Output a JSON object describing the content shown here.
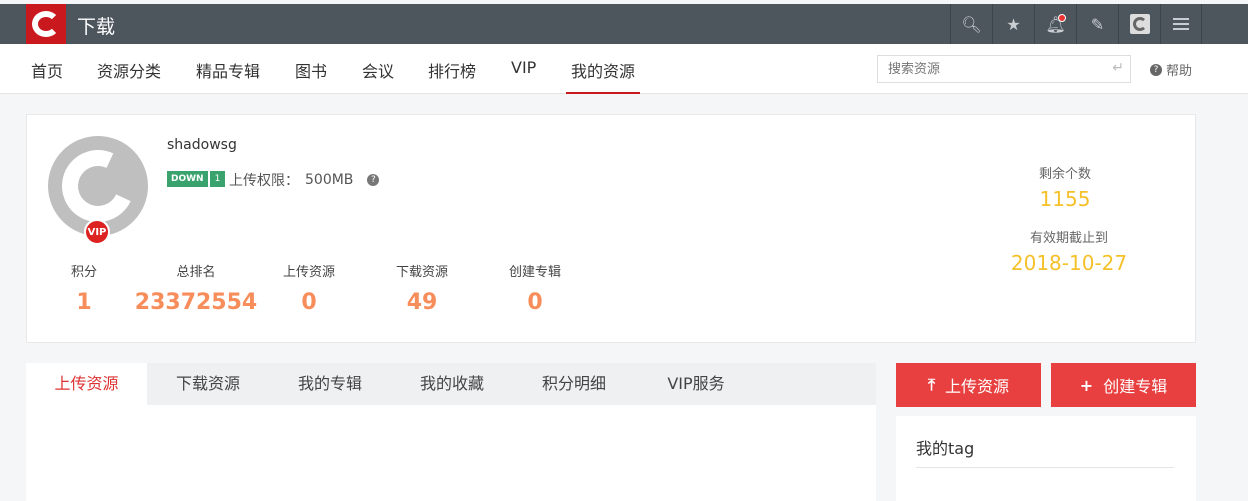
{
  "topbar": {
    "title": "下载"
  },
  "nav": {
    "items": [
      "首页",
      "资源分类",
      "精品专辑",
      "图书",
      "会议",
      "排行榜",
      "VIP",
      "我的资源"
    ],
    "search_placeholder": "搜索资源",
    "help_label": "帮助"
  },
  "profile": {
    "username": "shadowsg",
    "badge_left": "DOWN",
    "badge_right": "1",
    "upload_limit_label": "上传权限：",
    "upload_limit_value": "500MB",
    "vip": "VIP",
    "stats": [
      {
        "label": "积分",
        "value": "1"
      },
      {
        "label": "总排名",
        "value": "23372554"
      },
      {
        "label": "上传资源",
        "value": "0"
      },
      {
        "label": "下载资源",
        "value": "49"
      },
      {
        "label": "创建专辑",
        "value": "0"
      }
    ],
    "remaining_label": "剩余个数",
    "remaining_value": "1155",
    "expire_label": "有效期截止到",
    "expire_value": "2018-10-27"
  },
  "tabs": [
    "上传资源",
    "下载资源",
    "我的专辑",
    "我的收藏",
    "积分明细",
    "VIP服务"
  ],
  "actions": {
    "upload": "上传资源",
    "create_album": "创建专辑"
  },
  "tag_panel": {
    "title": "我的tag"
  },
  "colors": {
    "accent": "#c9191f",
    "stat": "#f78d5a",
    "gold": "#f5c12a",
    "button": "#e84040"
  }
}
